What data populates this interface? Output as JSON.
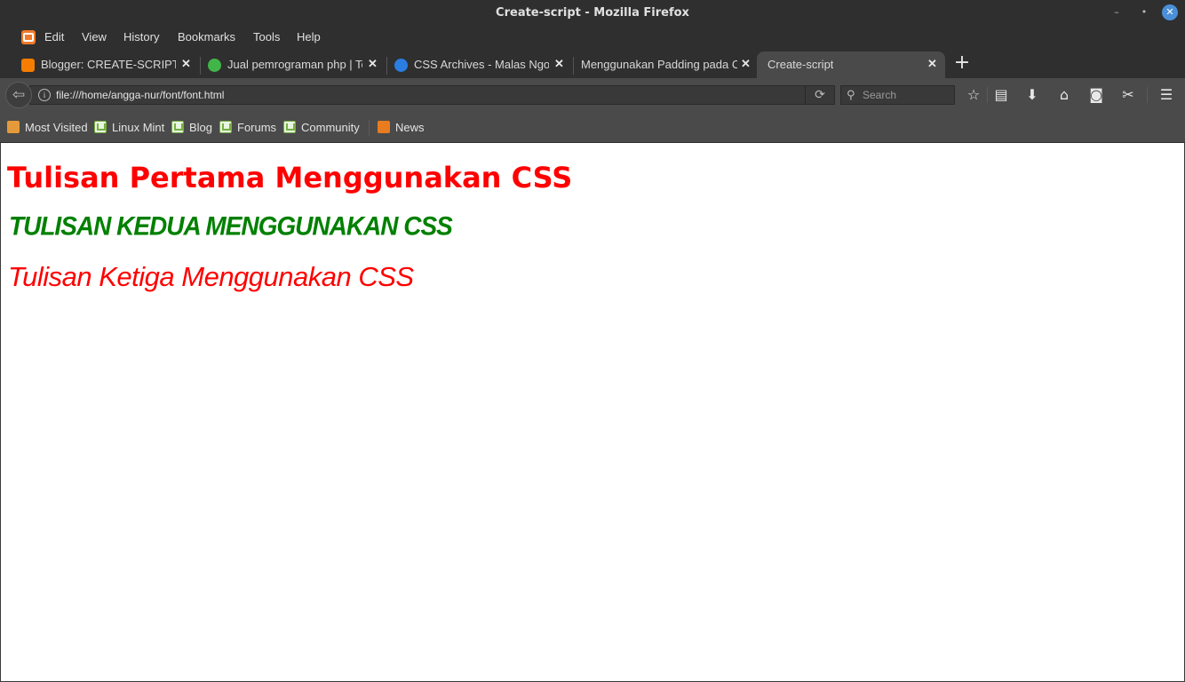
{
  "window": {
    "title": "Create-script - Mozilla Firefox",
    "controls": {
      "minimize": "–",
      "restore": "•",
      "close": "✕"
    }
  },
  "menu": {
    "items": [
      "Edit",
      "View",
      "History",
      "Bookmarks",
      "Tools",
      "Help"
    ]
  },
  "tabs": [
    {
      "label": "Blogger: CREATE-SCRIPT - A",
      "favicon": "blogger-icon",
      "color": "#f57d00"
    },
    {
      "label": "Jual pemrograman php | To",
      "favicon": "tokopedia-icon",
      "color": "#42b549"
    },
    {
      "label": "CSS Archives - Malas Ngodi",
      "favicon": "site-icon",
      "color": "#2a7de1"
    },
    {
      "label": "Menggunakan Padding pada CS",
      "favicon": "",
      "color": ""
    },
    {
      "label": "Create-script",
      "favicon": "",
      "color": "",
      "active": true
    }
  ],
  "navbar": {
    "url": "file:///home/angga-nur/font/font.html",
    "search_placeholder": "Search"
  },
  "bookmarks": [
    {
      "label": "Most Visited",
      "icon": "folder-icon"
    },
    {
      "label": "Linux Mint",
      "icon": "mint-icon"
    },
    {
      "label": "Blog",
      "icon": "mint-icon"
    },
    {
      "label": "Forums",
      "icon": "mint-icon"
    },
    {
      "label": "Community",
      "icon": "mint-icon"
    },
    {
      "label": "News",
      "icon": "rss-icon"
    }
  ],
  "page": {
    "heading1": "Tulisan Pertama Menggunakan CSS",
    "heading2": "Tulisan Kedua Menggunakan CSS",
    "heading3": "Tulisan Ketiga Menggunakan CSS",
    "colors": {
      "heading1": "#ff0000",
      "heading2": "#008000",
      "heading3": "#ff0000"
    }
  }
}
